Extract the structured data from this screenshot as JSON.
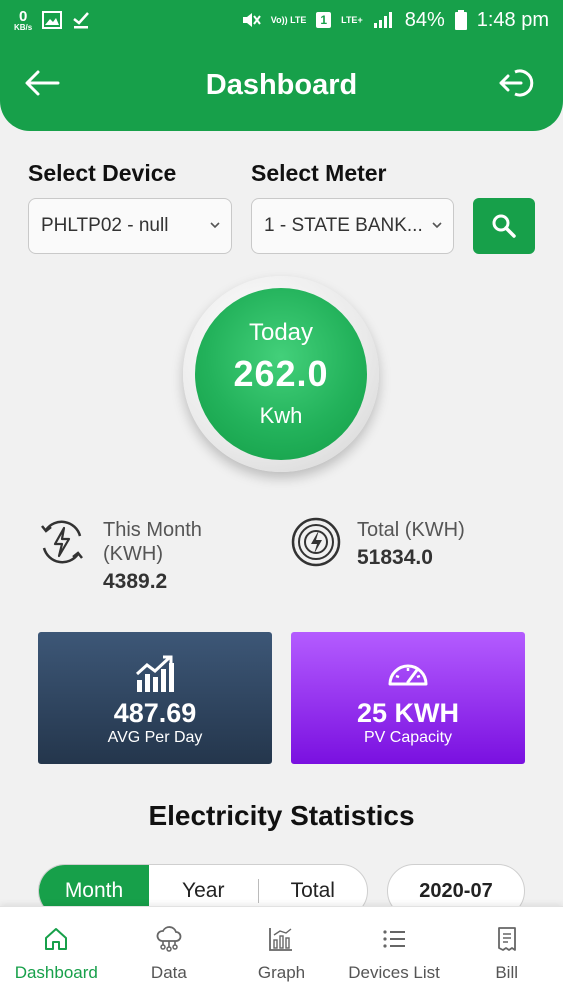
{
  "status_bar": {
    "speed_value": "0",
    "speed_unit": "KB/s",
    "volte": "Vo)) LTE",
    "sim": "1",
    "network": "LTE+",
    "battery": "84%",
    "time": "1:48 pm"
  },
  "header": {
    "title": "Dashboard",
    "back_icon": "arrow-left-icon",
    "logout_icon": "logout-icon"
  },
  "selectors": {
    "device_label": "Select Device",
    "device_value": "PHLTP02 - null",
    "meter_label": "Select Meter",
    "meter_value": "1 - STATE BANK..."
  },
  "today": {
    "label": "Today",
    "value": "262.0",
    "unit": "Kwh"
  },
  "stats": {
    "month_label_1": "This Month",
    "month_label_2": "(KWH)",
    "month_value": "4389.2",
    "total_label": "Total (KWH)",
    "total_value": "51834.0"
  },
  "cards": {
    "avg_value": "487.69",
    "avg_label": "AVG Per Day",
    "pv_value": "25 KWH",
    "pv_label": "PV Capacity"
  },
  "electricity": {
    "title": "Electricity Statistics",
    "tabs": [
      "Month",
      "Year",
      "Total"
    ],
    "active_tab": "Month",
    "period": "2020-07"
  },
  "nav": {
    "items": [
      "Dashboard",
      "Data",
      "Graph",
      "Devices List",
      "Bill"
    ],
    "active": "Dashboard"
  },
  "colors": {
    "primary": "#17a04a",
    "avg_card": "#2c415c",
    "pv_card": "#9a30f5"
  }
}
